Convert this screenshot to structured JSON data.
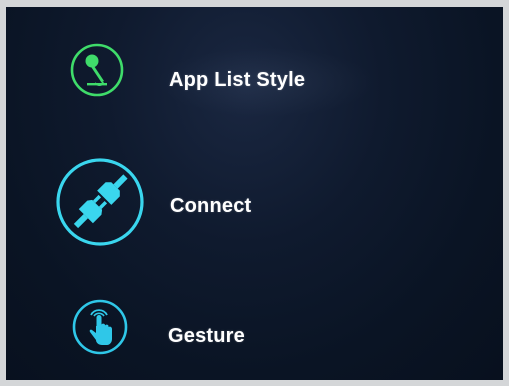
{
  "menu": {
    "items": [
      {
        "label": "App List Style",
        "icon": "microphone-icon",
        "color": "#3fdc6a",
        "selected": false
      },
      {
        "label": "Connect",
        "icon": "plug-icon",
        "color": "#3ad6ee",
        "selected": true
      },
      {
        "label": "Gesture",
        "icon": "hand-pointer-icon",
        "color": "#2fc7e8",
        "selected": false
      }
    ]
  },
  "colors": {
    "background": "#0c1628",
    "bezel": "#d4d6d8",
    "text": "#ffffff"
  }
}
